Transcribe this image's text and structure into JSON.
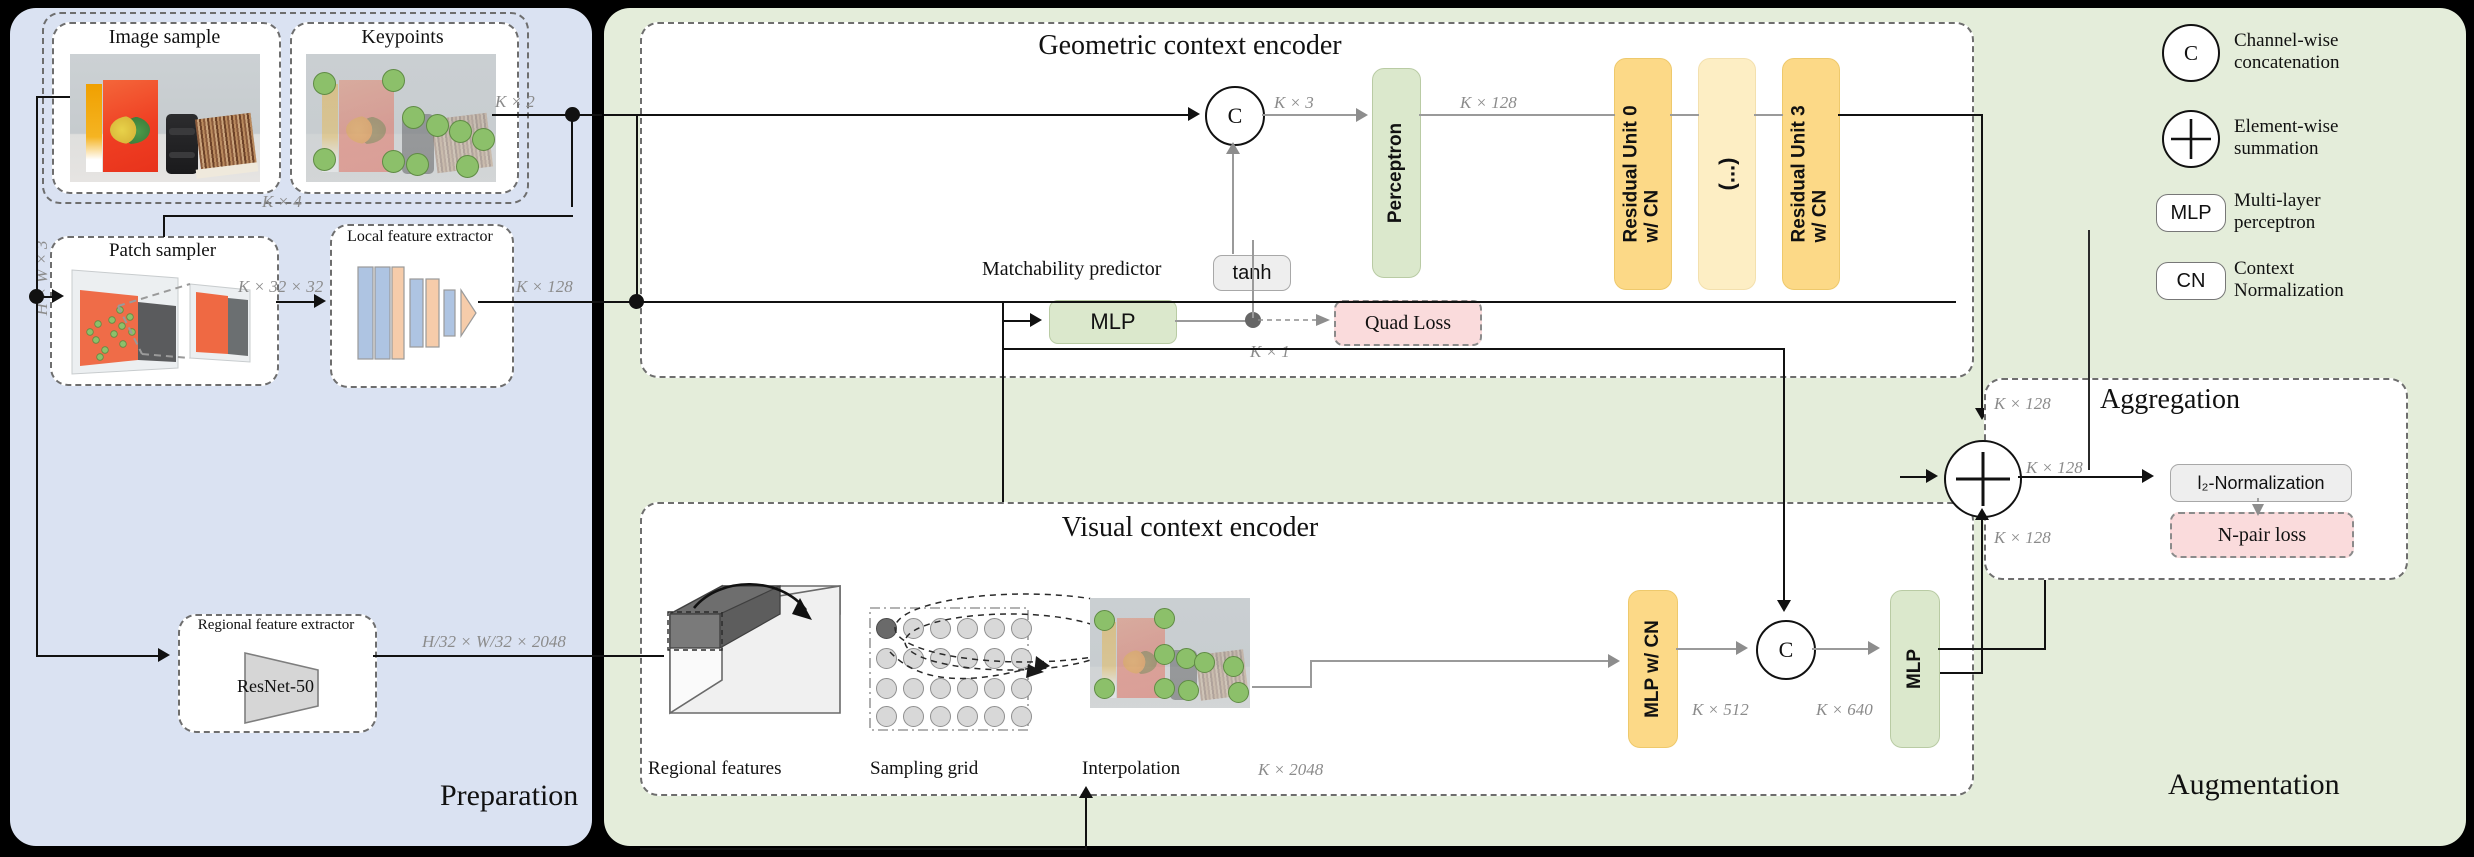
{
  "panels": {
    "preparation": {
      "label": "Preparation",
      "bg": "#dae2f2"
    },
    "augmentation": {
      "label": "Augmentation",
      "bg": "#e4edda"
    }
  },
  "preparation": {
    "boxes": {
      "image_sample": "Image sample",
      "keypoints": "Keypoints",
      "patch_sampler": "Patch sampler",
      "local_feature_extractor": "Local feature extractor",
      "regional_feature_extractor": "Regional feature extractor",
      "resnet": "ResNet-50"
    },
    "dims": {
      "input": "H × W × 3",
      "kp_out": "K × 2",
      "kp4": "K × 4",
      "patch_out": "K × 32 × 32",
      "local_out": "K × 128",
      "regional_out": "H/32 × W/32 × 2048"
    }
  },
  "geometric_encoder": {
    "title": "Geometric context encoder",
    "concat_symbol": "C",
    "blocks": [
      {
        "label": "Perceptron",
        "style": "green"
      },
      {
        "label": "Residual Unit 0 w/ CN",
        "style": "yellow"
      },
      {
        "label": "(...)",
        "style": "pale"
      },
      {
        "label": "Residual Unit 3 w/ CN",
        "style": "yellow"
      }
    ],
    "dims": {
      "concat_out": "K × 3",
      "perceptron_out": "K × 128",
      "encoder_out": "K × 128"
    }
  },
  "matchability": {
    "title": "Matchability predictor",
    "mlp": "MLP",
    "tanh": "tanh",
    "loss": "Quad Loss",
    "dim": "K × 1"
  },
  "visual_encoder": {
    "title": "Visual context encoder",
    "captions": {
      "regional_features": "Regional features",
      "sampling_grid": "Sampling grid",
      "interpolation": "Interpolation"
    },
    "blocks": [
      {
        "label": "MLP w/ CN",
        "style": "yellow"
      },
      {
        "label": "MLP",
        "style": "green"
      }
    ],
    "concat_symbol": "C",
    "dims": {
      "interp_out": "K × 2048",
      "mlpcn_out": "K × 512",
      "concat_out": "K × 640",
      "encoder_out": "K × 128"
    }
  },
  "aggregation": {
    "title": "Aggregation",
    "sum_symbol": "+",
    "normalization": "l₂-Normalization",
    "loss": "N-pair loss",
    "dims": {
      "top_in": "K × 128",
      "bottom_in": "K × 128",
      "out": "K × 128"
    }
  },
  "legend": [
    {
      "symbol": "C",
      "kind": "circle",
      "line1": "Channel-wise",
      "line2": "concatenation"
    },
    {
      "symbol": "+",
      "kind": "circle-plus",
      "line1": "Element-wise",
      "line2": "summation"
    },
    {
      "symbol": "MLP",
      "kind": "pill",
      "line1": "Multi-layer",
      "line2": "perceptron"
    },
    {
      "symbol": "CN",
      "kind": "pill",
      "line1": "Context",
      "line2": "Normalization"
    }
  ],
  "colors": {
    "prep_bg": "#dae2f2",
    "aug_bg": "#e4edda",
    "green_block": "#dbe8cc",
    "yellow_block": "#fcd987",
    "pale_block": "#fdeec4",
    "loss_block": "#fadbdc",
    "keypoint": "#8cc06a",
    "dim_text": "#8b8b8b"
  }
}
